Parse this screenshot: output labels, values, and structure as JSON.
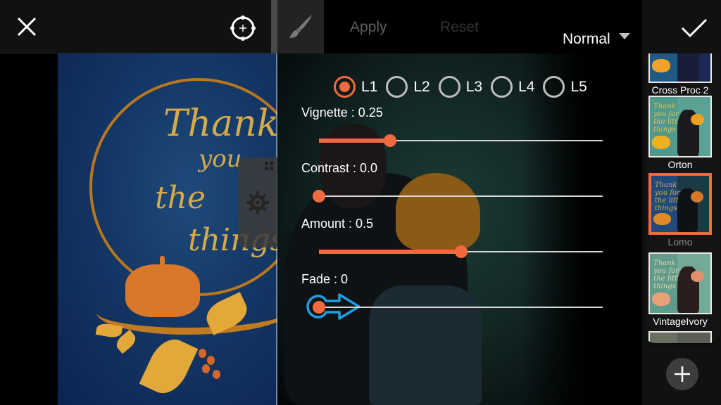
{
  "toolbar": {
    "close_icon": "close-icon",
    "target_icon": "crosshair-target-icon",
    "brush_icon": "paintbrush-icon",
    "apply_label": "Apply",
    "reset_label": "Reset",
    "blend_mode": "Normal",
    "confirm_icon": "checkmark-icon"
  },
  "levels": {
    "selected": "L1",
    "options": [
      {
        "label": "L1",
        "selected": true
      },
      {
        "label": "L2",
        "selected": false
      },
      {
        "label": "L3",
        "selected": false
      },
      {
        "label": "L4",
        "selected": false
      },
      {
        "label": "L5",
        "selected": false
      }
    ]
  },
  "sliders": [
    {
      "name": "Vignette",
      "label": "Vignette : 0.25",
      "value": 0.25,
      "fraction": 0.25
    },
    {
      "name": "Contrast",
      "label": "Contrast : 0.0",
      "value": 0.0,
      "fraction": 0.0
    },
    {
      "name": "Amount",
      "label": "Amount : 0.5",
      "value": 0.5,
      "fraction": 0.5
    },
    {
      "name": "Fade",
      "label": "Fade : 0",
      "value": 0,
      "fraction": 0.0
    }
  ],
  "hint": {
    "icon": "drag-right-hint-icon",
    "color": "#1ea0e0"
  },
  "canvas": {
    "card_text": [
      "Thank",
      "you",
      "the",
      "little things"
    ]
  },
  "presets": {
    "selected": "Lomo",
    "items": [
      {
        "label": "Cross Proc 2"
      },
      {
        "label": "Orton"
      },
      {
        "label": "Lomo"
      },
      {
        "label": "VintageIvory"
      },
      {
        "label": ""
      }
    ],
    "add_icon": "plus-icon"
  },
  "colors": {
    "accent": "#f2693f",
    "hint_blue": "#1ea0e0",
    "toolbar_bg": "#111111",
    "inactive_text": "#5f5f5f"
  }
}
